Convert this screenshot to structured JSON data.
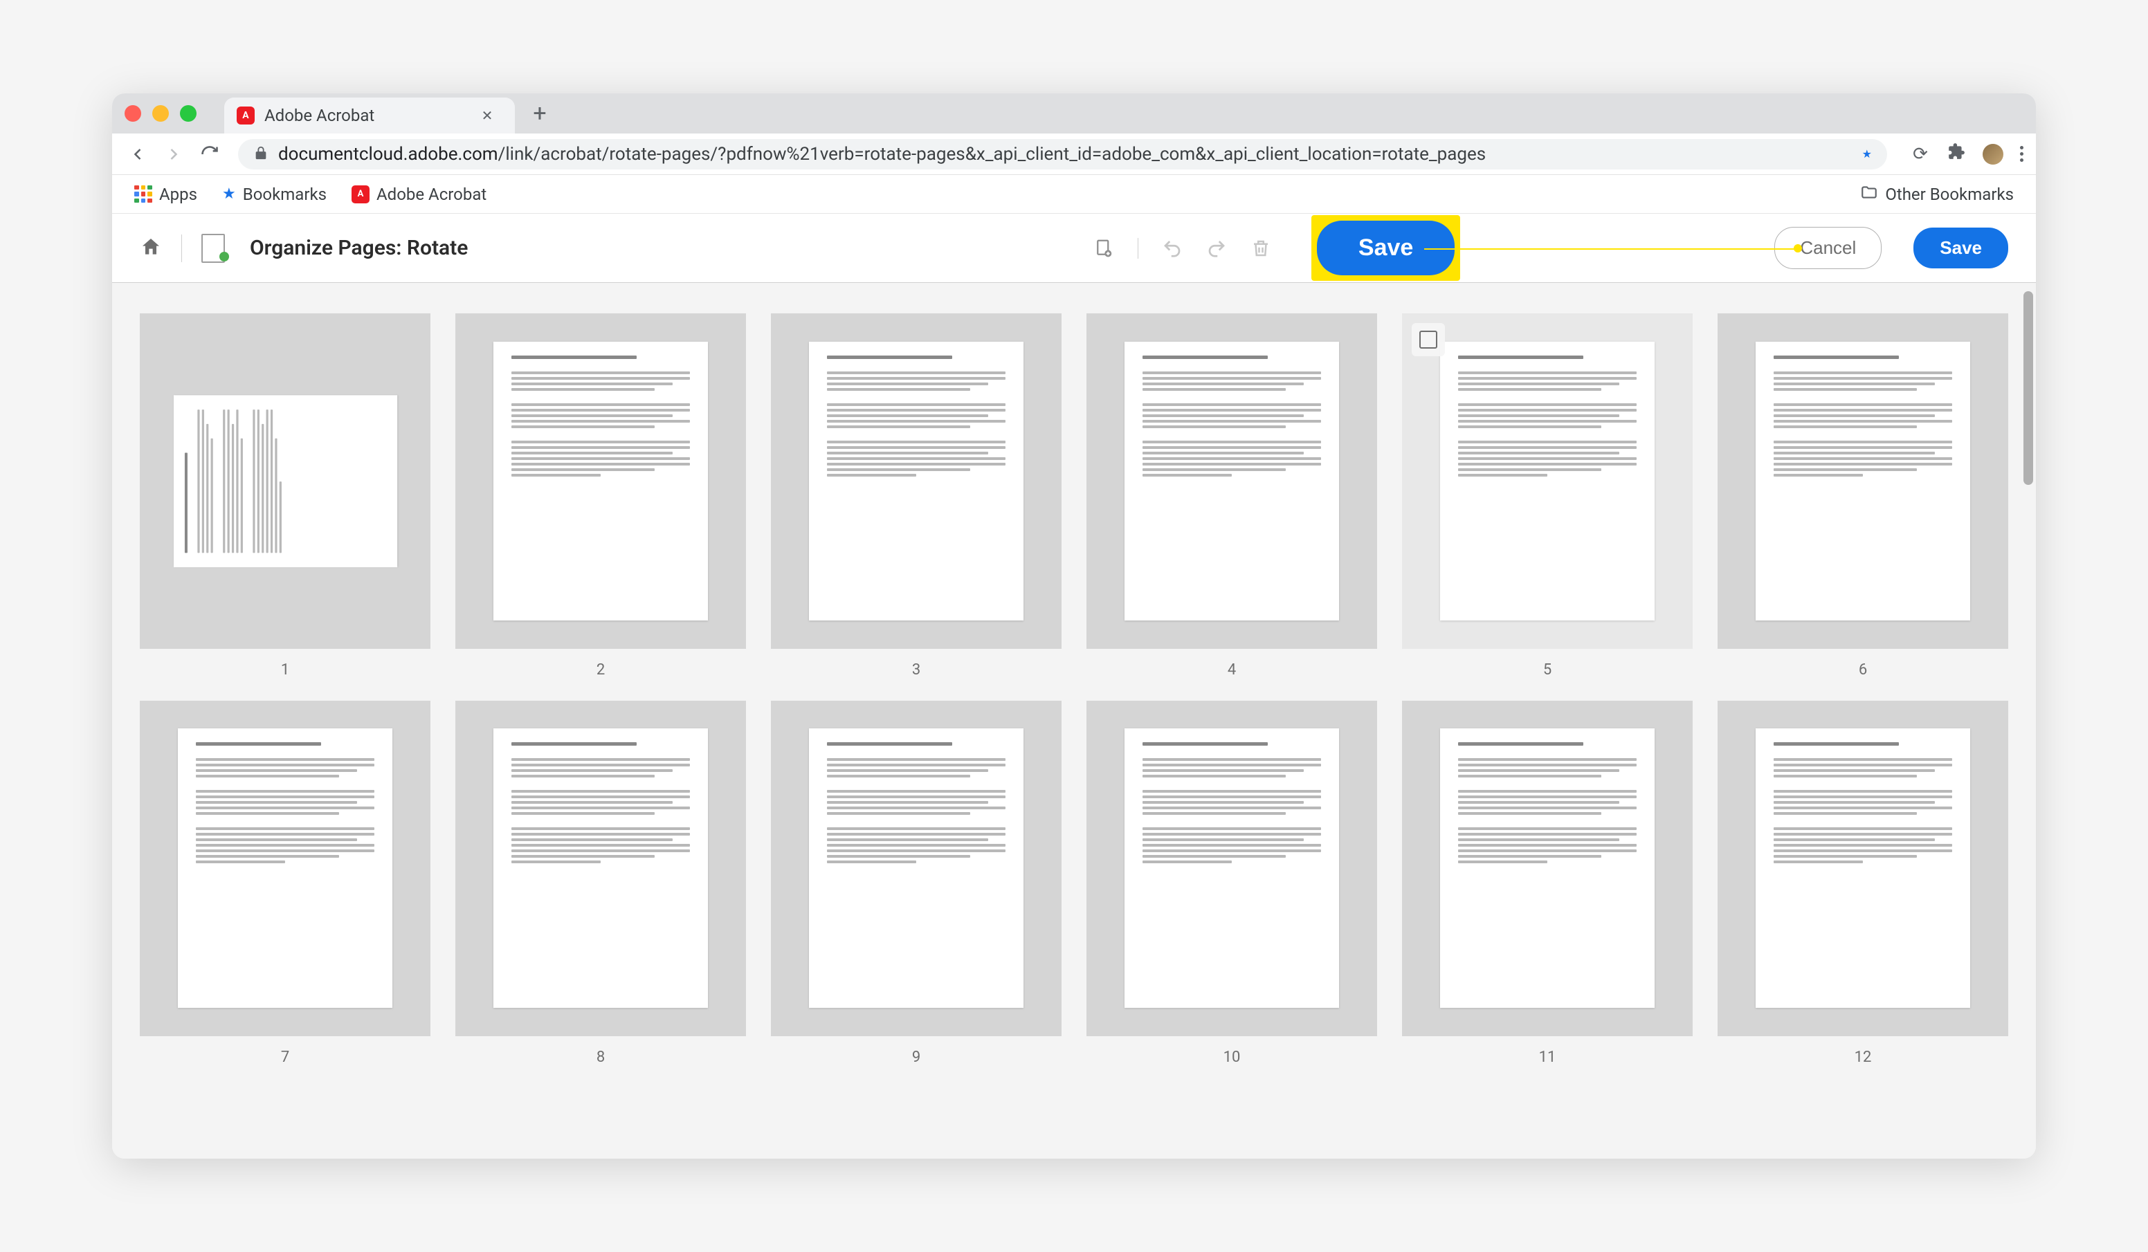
{
  "browser": {
    "tab_title": "Adobe Acrobat",
    "url_domain": "documentcloud.adobe.com",
    "url_path": "/link/acrobat/rotate-pages/?pdfnow%21verb=rotate-pages&x_api_client_id=adobe_com&x_api_client_location=rotate_pages",
    "bookmarks_bar": {
      "apps": "Apps",
      "bookmarks": "Bookmarks",
      "adobe_acrobat": "Adobe Acrobat",
      "other_bookmarks": "Other Bookmarks"
    }
  },
  "app": {
    "title": "Organize Pages: Rotate",
    "save_main_label": "Save",
    "cancel_label": "Cancel",
    "save_label": "Save"
  },
  "pages": [
    {
      "num": "1",
      "rotated": true
    },
    {
      "num": "2",
      "rotated": false
    },
    {
      "num": "3",
      "rotated": false
    },
    {
      "num": "4",
      "rotated": false
    },
    {
      "num": "5",
      "rotated": false,
      "hovered": true
    },
    {
      "num": "6",
      "rotated": false
    },
    {
      "num": "7",
      "rotated": false
    },
    {
      "num": "8",
      "rotated": false
    },
    {
      "num": "9",
      "rotated": false
    },
    {
      "num": "10",
      "rotated": false
    },
    {
      "num": "11",
      "rotated": false
    },
    {
      "num": "12",
      "rotated": false
    }
  ]
}
